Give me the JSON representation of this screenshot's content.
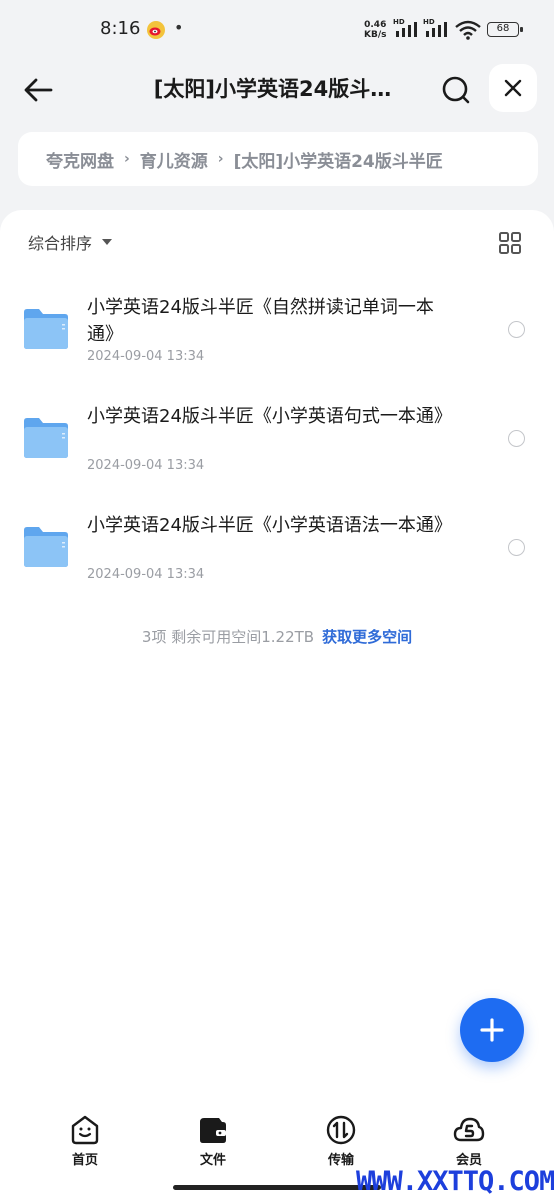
{
  "status_bar": {
    "time": "8:16",
    "dot": "•",
    "net_speed_value": "0.46",
    "net_speed_unit": "KB/s",
    "hd_tag": "HD",
    "battery": "68"
  },
  "header": {
    "title": "[太阳]小学英语24版斗…"
  },
  "breadcrumb": {
    "items": [
      "夸克网盘",
      "育儿资源",
      "[太阳]小学英语24版斗半匠"
    ],
    "separator": "›"
  },
  "toolbar": {
    "sort_label": "综合排序"
  },
  "files": [
    {
      "name": "小学英语24版斗半匠《自然拼读记单词一本通》",
      "date": "2024-09-04 13:34"
    },
    {
      "name": "小学英语24版斗半匠《小学英语句式一本通》",
      "date": "2024-09-04 13:34"
    },
    {
      "name": "小学英语24版斗半匠《小学英语语法一本通》",
      "date": "2024-09-04 13:34"
    }
  ],
  "summary": {
    "text": "3项 剩余可用空间1.22TB",
    "link": "获取更多空间"
  },
  "bottom_nav": {
    "items": [
      {
        "label": "首页",
        "icon": "home-face-icon"
      },
      {
        "label": "文件",
        "icon": "wallet-folder-icon"
      },
      {
        "label": "传输",
        "icon": "transfer-icon"
      },
      {
        "label": "会员",
        "icon": "vip-cloud-icon"
      }
    ]
  },
  "watermark": "WWW.XXTTQ.COM",
  "colors": {
    "accent": "#1e6cf2",
    "link": "#2f6bd8",
    "folder": "#74b6f2",
    "background": "#f2f3f5"
  }
}
